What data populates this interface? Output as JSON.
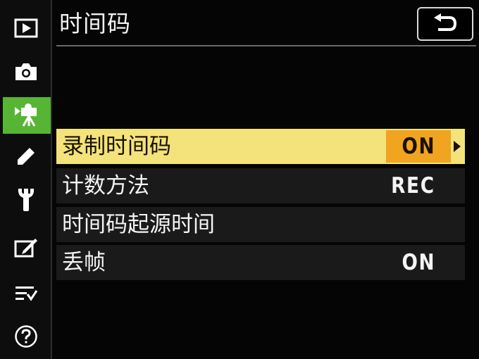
{
  "header": {
    "title": "时间码",
    "back_icon": "return-arrow-icon"
  },
  "sidebar": {
    "tabs": [
      {
        "icon": "playback-icon"
      },
      {
        "icon": "camera-icon"
      },
      {
        "icon": "movie-camera-icon",
        "active": true
      },
      {
        "icon": "pencil-icon"
      },
      {
        "icon": "wrench-icon"
      },
      {
        "icon": "retouch-icon"
      },
      {
        "icon": "my-menu-icon"
      },
      {
        "icon": "help-icon"
      }
    ],
    "active_color": "#56b534"
  },
  "menu": {
    "items": [
      {
        "label": "录制时间码",
        "value": "ON",
        "selected": true
      },
      {
        "label": "计数方法",
        "value": "REC"
      },
      {
        "label": "时间码起源时间",
        "value": ""
      },
      {
        "label": "丢帧",
        "value": "ON"
      }
    ],
    "highlight_color": "#f3e37a",
    "value_highlight_color": "#f1a420"
  }
}
